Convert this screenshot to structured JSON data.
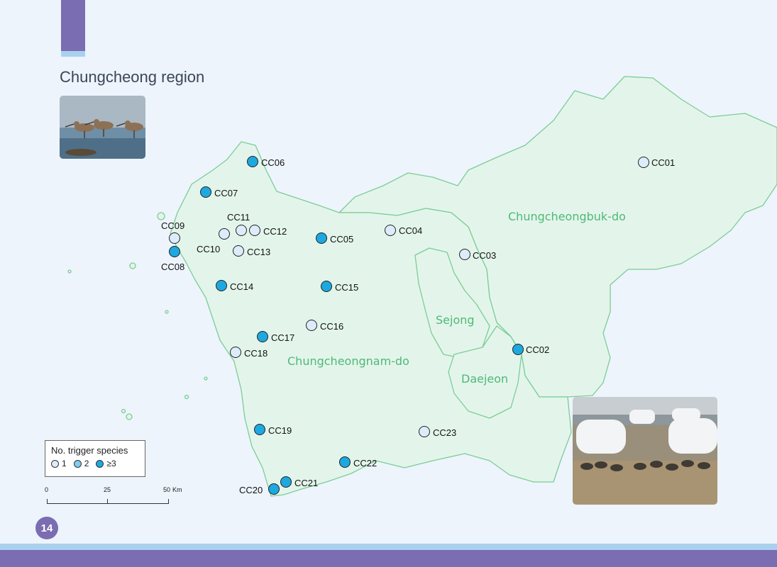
{
  "page": {
    "title": "Chungcheong region",
    "page_number": "14"
  },
  "colors": {
    "brand_purple": "#7a6db1",
    "accent_light_blue": "#a9d1ef",
    "land_fill": "#e3f5ea",
    "boundary": "#7dcc98",
    "region_label": "#4fb879",
    "class_1": "#dcecfa",
    "class_2": "#7fcdf0",
    "class_3": "#1ea8e0"
  },
  "regions": [
    {
      "name": "Chungcheongbuk-do"
    },
    {
      "name": "Chungcheongnam-do"
    },
    {
      "name": "Sejong"
    },
    {
      "name": "Daejeon"
    }
  ],
  "legend": {
    "title": "No. trigger species",
    "items": [
      {
        "label": "1",
        "class": "class_1"
      },
      {
        "label": "2",
        "class": "class_2"
      },
      {
        "label": "≥3",
        "class": "class_3"
      }
    ]
  },
  "scale": {
    "ticks": [
      "0",
      "25",
      "50"
    ],
    "unit": "Km"
  },
  "sites": [
    {
      "id": "CC01",
      "class": 1
    },
    {
      "id": "CC02",
      "class": 3
    },
    {
      "id": "CC03",
      "class": 1
    },
    {
      "id": "CC04",
      "class": 1
    },
    {
      "id": "CC05",
      "class": 3
    },
    {
      "id": "CC06",
      "class": 3
    },
    {
      "id": "CC07",
      "class": 3
    },
    {
      "id": "CC08",
      "class": 3
    },
    {
      "id": "CC09",
      "class": 1
    },
    {
      "id": "CC10",
      "class": 1
    },
    {
      "id": "CC11",
      "class": 1
    },
    {
      "id": "CC12",
      "class": 1
    },
    {
      "id": "CC13",
      "class": 1
    },
    {
      "id": "CC14",
      "class": 3
    },
    {
      "id": "CC15",
      "class": 3
    },
    {
      "id": "CC16",
      "class": 1
    },
    {
      "id": "CC17",
      "class": 3
    },
    {
      "id": "CC18",
      "class": 1
    },
    {
      "id": "CC19",
      "class": 3
    },
    {
      "id": "CC20",
      "class": 3
    },
    {
      "id": "CC21",
      "class": 3
    },
    {
      "id": "CC22",
      "class": 3
    },
    {
      "id": "CC23",
      "class": 1
    }
  ],
  "photos": [
    {
      "subject": "shorebirds"
    },
    {
      "subject": "geese-field"
    }
  ]
}
